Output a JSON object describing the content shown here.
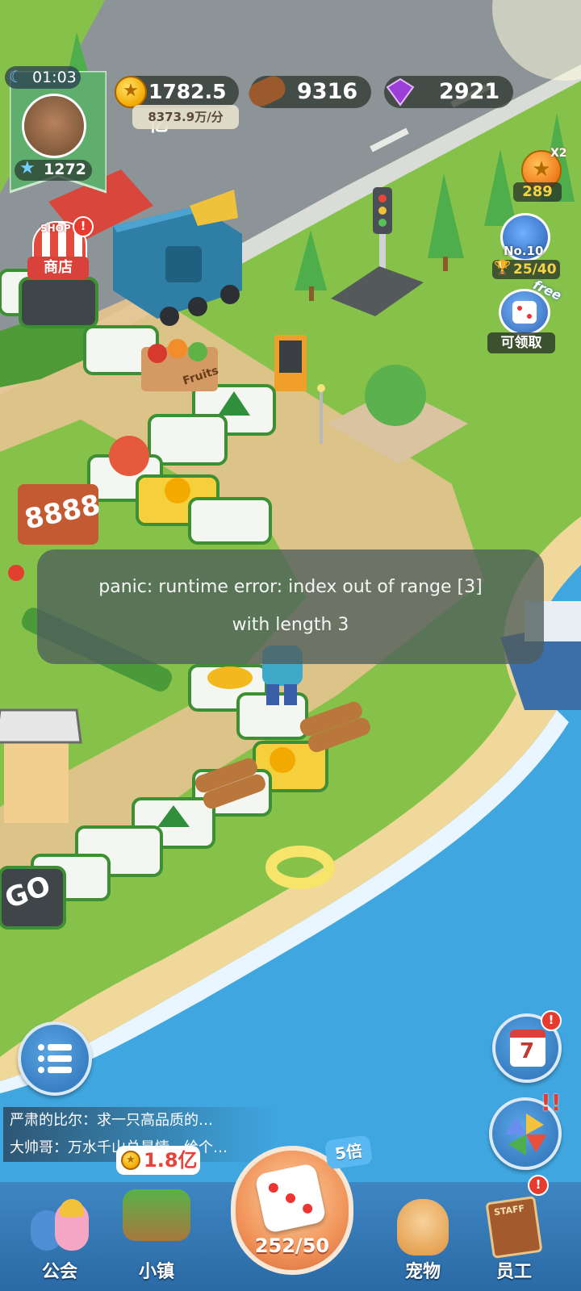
{
  "hud": {
    "timer": "01:03",
    "level": "1272",
    "coins": "1782.5亿",
    "coin_rate": "8373.9万/分",
    "wood": "9316",
    "gems": "2921"
  },
  "shop": {
    "sign": "SHOP",
    "label": "商店",
    "badge": "!"
  },
  "right_panel": {
    "x2_label": "X2",
    "x2_count": "289",
    "rank_label": "No.10",
    "rank_progress": "25/40",
    "free_tag": "free",
    "claim_label": "可领取"
  },
  "board": {
    "sign_8888": "8888",
    "go_text": "GO",
    "fruits_label": "Fruits"
  },
  "error_toast": {
    "line1": "panic: runtime error: index out of range [3]",
    "line2": "with length 3"
  },
  "calendar": {
    "day": "7",
    "badge": "!"
  },
  "pinwheel": {
    "badge": "!!"
  },
  "chat": [
    {
      "text": "严肃的比尔：求一只高品质的…"
    },
    {
      "text": "大帅哥：万水千山总是情。给个…"
    }
  ],
  "nav": {
    "guild_label": "公会",
    "town_label": "小镇",
    "town_cost": "1.8亿",
    "dice_count": "252/50",
    "multiplier": "5倍",
    "pet_label": "宠物",
    "staff_label": "员工",
    "staff_badge": "!",
    "staff_sign": "STAFF"
  },
  "colors": {
    "grass": "#86c24a",
    "road": "#8d9498",
    "sea": "#3fa6e0",
    "sand": "#f0d79a",
    "accent_gold": "#f2a900",
    "gem_purple": "#9b3fd6"
  }
}
